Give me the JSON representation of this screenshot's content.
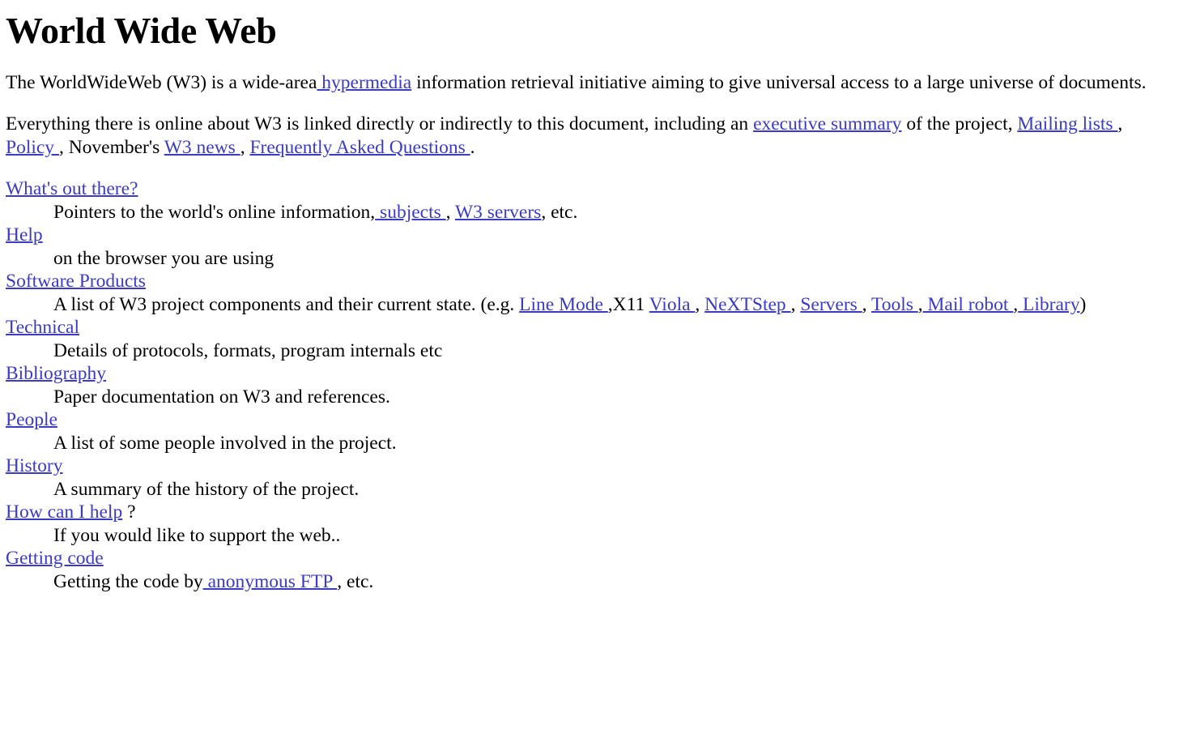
{
  "page": {
    "title": "World Wide Web",
    "link_color": "#3b3bc4",
    "text_color": "#000000",
    "background_color": "#ffffff"
  },
  "intro": {
    "part1": "The WorldWideWeb (W3) is a wide-area",
    "link_hypermedia": " hypermedia",
    "part2": " information retrieval initiative aiming to give universal access to a large universe of documents."
  },
  "linked_para": {
    "part1": "Everything there is online about W3 is linked directly or indirectly to this document, including an ",
    "link_executive_summary": "executive summary",
    "part2": " of the project, ",
    "link_mailing_lists": "Mailing lists ",
    "part3": ", ",
    "link_policy": "Policy ",
    "part4": ", November's ",
    "link_w3_news": "W3 news ",
    "part5": ", ",
    "link_faq": "Frequently Asked Questions ",
    "part6": "."
  },
  "entries": [
    {
      "term": "What's out there?",
      "desc_part1": "Pointers to the world's online information,",
      "desc_link1": " subjects ",
      "desc_part2": ", ",
      "desc_link2": "W3 servers",
      "desc_part3": ", etc."
    },
    {
      "term": "Help",
      "desc_part1": "on the browser you are using"
    },
    {
      "term": "Software Products",
      "desc_part1": "A list of W3 project components and their current state. (e.g. ",
      "links": [
        "Line Mode ",
        "Viola ",
        "NeXTStep ",
        "Servers ",
        "Tools ",
        " Mail robot ",
        " Library"
      ],
      "sep_x11": ",X11 ",
      "sep_comma": ", ",
      "sep_comma_tight": ",",
      "desc_end": ")"
    },
    {
      "term": "Technical",
      "desc_part1": "Details of protocols, formats, program internals etc"
    },
    {
      "term": "Bibliography",
      "desc_part1": "Paper documentation on W3 and references."
    },
    {
      "term": "People",
      "desc_part1": "A list of some people involved in the project."
    },
    {
      "term": "History",
      "desc_part1": "A summary of the history of the project."
    },
    {
      "term": "How can I help",
      "term_suffix": " ?",
      "desc_part1": "If you would like to support the web.."
    },
    {
      "term": "Getting code",
      "desc_part1": "Getting the code by",
      "desc_link1": " anonymous FTP ",
      "desc_part2": ", etc."
    }
  ]
}
